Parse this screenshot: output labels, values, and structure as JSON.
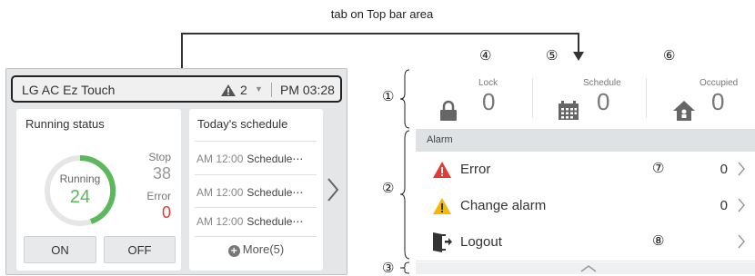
{
  "caption": "tab on Top bar area",
  "left_device": {
    "topbar": {
      "title": "LG AC Ez Touch",
      "alarm_count": "2",
      "time": "PM 03:28"
    },
    "running_status": {
      "title": "Running status",
      "running_label": "Running",
      "running_value": "24",
      "stop_label": "Stop",
      "stop_value": "38",
      "error_label": "Error",
      "error_value": "0",
      "on_label": "ON",
      "off_label": "OFF"
    },
    "schedule": {
      "title": "Today's schedule",
      "rows": [
        {
          "time": "AM 12:00",
          "name": "Schedule⋯"
        },
        {
          "time": "AM 12:00",
          "name": "Schedule⋯"
        },
        {
          "time": "AM 12:00",
          "name": "Schedule⋯"
        }
      ],
      "more_label": "More(5)"
    }
  },
  "callouts": {
    "n1": "①",
    "n2": "②",
    "n3": "③",
    "n4": "④",
    "n5": "⑤",
    "n6": "⑥",
    "n7": "⑦",
    "n8": "⑧"
  },
  "right_screen": {
    "status": [
      {
        "label": "Lock",
        "value": "0",
        "icon": "lock-icon"
      },
      {
        "label": "Schedule",
        "value": "0",
        "icon": "calendar-icon"
      },
      {
        "label": "Occupied",
        "value": "0",
        "icon": "home-icon"
      }
    ],
    "alarm_header": "Alarm",
    "menu": [
      {
        "label": "Error",
        "value": "0",
        "icon": "error-icon"
      },
      {
        "label": "Change alarm",
        "value": "0",
        "icon": "warning-icon"
      },
      {
        "label": "Logout",
        "value": "",
        "icon": "logout-icon"
      }
    ]
  },
  "colors": {
    "running_green": "#5cb85c",
    "error_red": "#e53935",
    "warning_yellow": "#f5b800"
  }
}
